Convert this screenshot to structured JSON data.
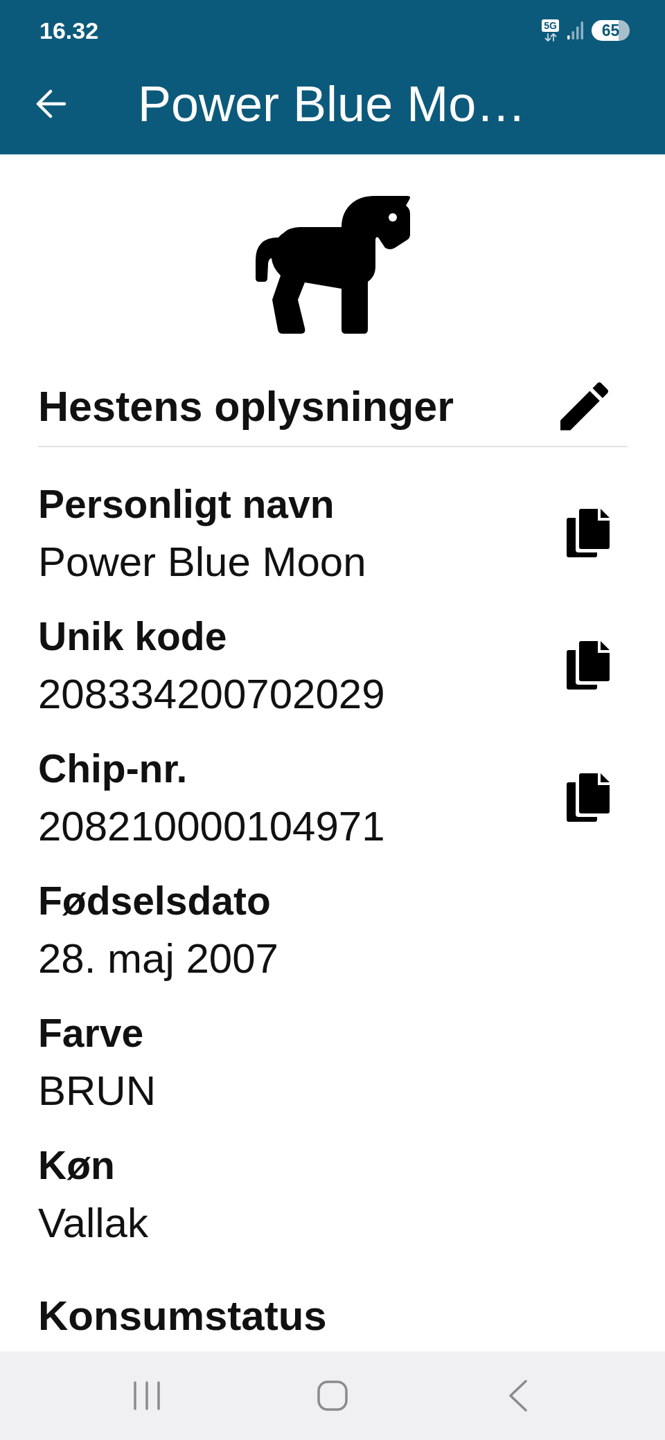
{
  "status_bar": {
    "time": "16.32",
    "network": "5G",
    "battery": "65"
  },
  "app_bar": {
    "title": "Power Blue Mo…"
  },
  "section": {
    "title": "Hestens oplysninger",
    "editable": true,
    "fields": [
      {
        "label": "Personligt navn",
        "value": "Power Blue Moon",
        "copyable": true
      },
      {
        "label": "Unik kode",
        "value": "208334200702029",
        "copyable": true
      },
      {
        "label": "Chip-nr.",
        "value": "208210000104971",
        "copyable": true
      },
      {
        "label": "Fødselsdato",
        "value": "28. maj 2007",
        "copyable": false
      },
      {
        "label": "Farve",
        "value": "BRUN",
        "copyable": false
      },
      {
        "label": "Køn",
        "value": "Vallak",
        "copyable": false
      }
    ]
  },
  "next_section": {
    "title": "Konsumstatus"
  }
}
